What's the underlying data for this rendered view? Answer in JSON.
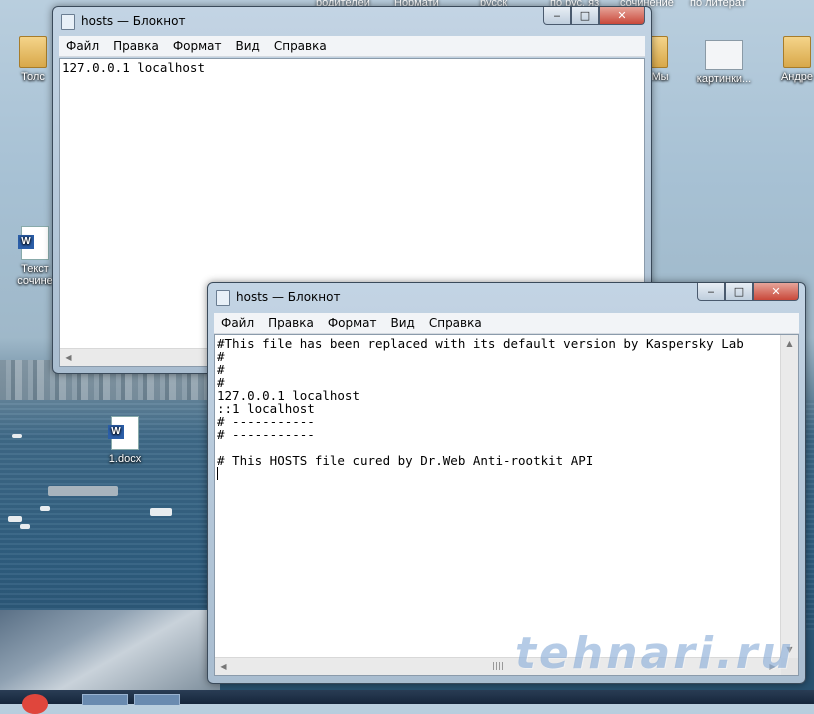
{
  "desktop": {
    "top_labels": [
      "родителей",
      "Нормати",
      "русск",
      "по рус. яз",
      "сочинение",
      "по литерат"
    ],
    "icons": [
      {
        "label": "Толс",
        "type": "folder"
      },
      {
        "label": "Мы",
        "type": "folder"
      },
      {
        "label": "картинки...",
        "type": "picture"
      },
      {
        "label": "Андре",
        "type": "folder"
      },
      {
        "label": "Текст сочине",
        "type": "word-doc"
      },
      {
        "label": "1.docx",
        "type": "word-doc"
      }
    ],
    "watermark": "tehnari.ru"
  },
  "window_back": {
    "title": "hosts — Блокнот",
    "menu": [
      "Файл",
      "Правка",
      "Формат",
      "Вид",
      "Справка"
    ],
    "content": "127.0.0.1 localhost"
  },
  "window_front": {
    "title": "hosts — Блокнот",
    "menu": [
      "Файл",
      "Правка",
      "Формат",
      "Вид",
      "Справка"
    ],
    "content": "#This file has been replaced with its default version by Kaspersky Lab\n#\n#\n#\n127.0.0.1 localhost\n::1 localhost\n# -----------\n# -----------\n\n# This HOSTS file cured by Dr.Web Anti-rootkit API\n"
  },
  "caption": {
    "minimize": "‒",
    "maximize": "□",
    "close": "✕"
  },
  "icons": {
    "word_badge": "W"
  }
}
